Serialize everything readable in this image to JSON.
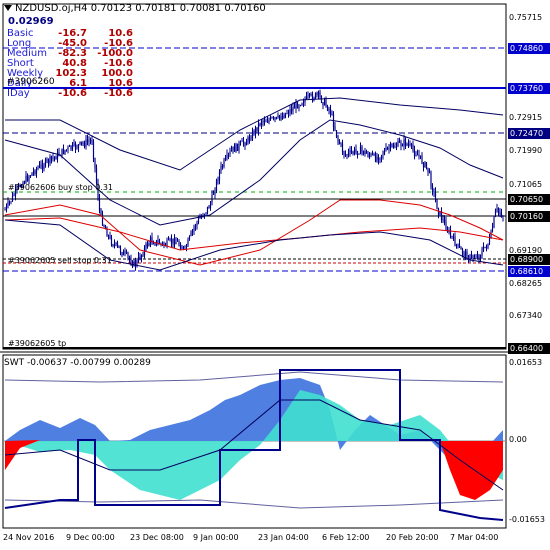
{
  "header": {
    "symbol": "NZDUSD.oj,H4",
    "ohlc": "0.70123 0.70181 0.70081 0.70160"
  },
  "current_price": "0.02969",
  "strength_table": [
    {
      "label": "Basic",
      "v1": "-16.7",
      "v2": "10.6"
    },
    {
      "label": "Long",
      "v1": "-45.0",
      "v2": "-10.6"
    },
    {
      "label": "Medium",
      "v1": "-82.3",
      "v2": "-100.0"
    },
    {
      "label": "Short",
      "v1": "40.8",
      "v2": "-10.6"
    },
    {
      "label": "Weekly",
      "v1": "102.3",
      "v2": "100.0"
    },
    {
      "label": "Daily",
      "v1": "6.1",
      "v2": "10.6"
    },
    {
      "label": "IDay",
      "v1": "-10.6",
      "v2": "-10.6"
    }
  ],
  "overlap_label": "#3906260",
  "order_labels": {
    "buy_stop": "#39062606 buy stop 0.31",
    "sell_stop": "#39062605 sell stop 0.31",
    "tp": "#39062605 tp"
  },
  "price_axis": {
    "ticks": [
      "0.75715",
      "0.72915",
      "0.71990",
      "0.71065",
      "0.70160",
      "0.69190",
      "0.68265",
      "0.67340"
    ],
    "tags": [
      {
        "text": "0.74860",
        "color": "#0000cc"
      },
      {
        "text": "0.73760",
        "color": "#0000cc"
      },
      {
        "text": "0.72470",
        "color": "#000080"
      },
      {
        "text": "0.70650",
        "color": "#000000"
      },
      {
        "text": "0.70160",
        "color": "#000000"
      },
      {
        "text": "0.68900",
        "color": "#000000"
      },
      {
        "text": "0.68610",
        "color": "#0000cc"
      },
      {
        "text": "0.66400",
        "color": "#000000"
      }
    ]
  },
  "indicator": {
    "title": "SWT -0.00637 -0.00799 0.00289",
    "ticks": [
      "0.01653",
      "0.00",
      "-0.01653"
    ],
    "colors": {
      "positive": "#ff0000",
      "area": "#40e0d0",
      "histogram": "#4f7fe0",
      "band": "#00008b"
    }
  },
  "time_axis": [
    "24 Nov 2016",
    "9 Dec 00:00",
    "23 Dec 08:00",
    "9 Jan 00:00",
    "23 Jan 04:00",
    "6 Feb 12:00",
    "20 Feb 20:00",
    "7 Mar 04:00"
  ],
  "colors": {
    "candles": "#00008b",
    "ma_red": "#dd0000",
    "level_blue": "#0000cc",
    "grid": "#000000"
  }
}
